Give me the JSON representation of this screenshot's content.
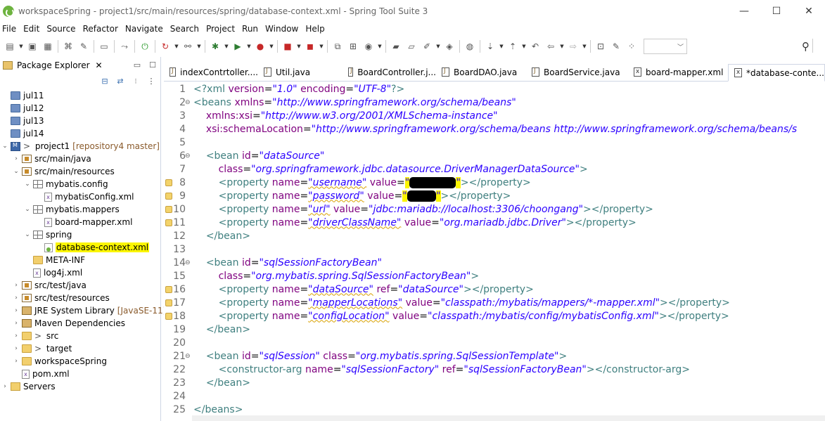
{
  "window": {
    "title": "workspaceSpring - project1/src/main/resources/spring/database-context.xml - Spring Tool Suite 3",
    "controls": [
      "—",
      "☐",
      "✕"
    ]
  },
  "menu": [
    "File",
    "Edit",
    "Source",
    "Refactor",
    "Navigate",
    "Search",
    "Project",
    "Run",
    "Window",
    "Help"
  ],
  "package_explorer": {
    "tab_label": "Package Explorer",
    "tree": [
      {
        "label": "jul11",
        "type": "proj-folder",
        "depth": 0,
        "twisty": ""
      },
      {
        "label": "jul12",
        "type": "proj-folder",
        "depth": 0,
        "twisty": ""
      },
      {
        "label": "jul13",
        "type": "proj-folder",
        "depth": 0,
        "twisty": ""
      },
      {
        "label": "jul14",
        "type": "proj-folder",
        "depth": 0,
        "twisty": ""
      },
      {
        "label": "project1",
        "prefix": "> ",
        "suffix": "[repository4 master]",
        "type": "project",
        "depth": 0,
        "twisty": "v"
      },
      {
        "label": "src/main/java",
        "type": "pkgroot",
        "depth": 1,
        "twisty": ">"
      },
      {
        "label": "src/main/resources",
        "type": "pkgroot",
        "depth": 1,
        "twisty": "v"
      },
      {
        "label": "mybatis.config",
        "type": "package",
        "depth": 2,
        "twisty": "v"
      },
      {
        "label": "mybatisConfig.xml",
        "type": "xml",
        "depth": 3,
        "twisty": ""
      },
      {
        "label": "mybatis.mappers",
        "type": "package",
        "depth": 2,
        "twisty": "v"
      },
      {
        "label": "board-mapper.xml",
        "type": "xml",
        "depth": 3,
        "twisty": ""
      },
      {
        "label": "spring",
        "type": "package",
        "depth": 2,
        "twisty": "v"
      },
      {
        "label": "database-context.xml",
        "type": "springxml",
        "depth": 3,
        "twisty": "",
        "highlight": true
      },
      {
        "label": "META-INF",
        "type": "folder",
        "depth": 2,
        "twisty": ""
      },
      {
        "label": "log4j.xml",
        "type": "xml",
        "depth": 2,
        "twisty": ""
      },
      {
        "label": "src/test/java",
        "type": "pkgroot",
        "depth": 1,
        "twisty": ">"
      },
      {
        "label": "src/test/resources",
        "type": "pkgroot",
        "depth": 1,
        "twisty": ">"
      },
      {
        "label": "JRE System Library",
        "suffix": "[JavaSE-11]",
        "type": "lib",
        "depth": 1,
        "twisty": ">"
      },
      {
        "label": "Maven Dependencies",
        "type": "lib",
        "depth": 1,
        "twisty": ">"
      },
      {
        "label": "src",
        "prefix": "> ",
        "type": "folder",
        "depth": 1,
        "twisty": ">"
      },
      {
        "label": "target",
        "prefix": "> ",
        "type": "folder",
        "depth": 1,
        "twisty": ">"
      },
      {
        "label": "workspaceSpring",
        "type": "folder",
        "depth": 1,
        "twisty": ">"
      },
      {
        "label": "pom.xml",
        "type": "xml",
        "depth": 1,
        "twisty": ""
      },
      {
        "label": "Servers",
        "type": "servers",
        "depth": 0,
        "twisty": ">"
      }
    ]
  },
  "editor_tabs": [
    {
      "label": "indexContrtoller....",
      "icon": "java"
    },
    {
      "label": "Util.java",
      "icon": "java"
    },
    {
      "label": "BoardController.j...",
      "icon": "java"
    },
    {
      "label": "BoardDAO.java",
      "icon": "java"
    },
    {
      "label": "BoardService.java",
      "icon": "java"
    },
    {
      "label": "board-mapper.xml",
      "icon": "xml"
    },
    {
      "label": "*database-conte...",
      "icon": "xml",
      "active": true
    }
  ],
  "editor": {
    "lines": [
      {
        "n": "1",
        "segs": [
          [
            "t",
            "<?"
          ],
          [
            "t",
            "xml "
          ],
          [
            "a",
            "version"
          ],
          [
            "p",
            "="
          ],
          [
            "v",
            "\"1.0\""
          ],
          [
            "p",
            " "
          ],
          [
            "a",
            "encoding"
          ],
          [
            "p",
            "="
          ],
          [
            "v",
            "\"UTF-8\""
          ],
          [
            "t",
            "?>"
          ]
        ]
      },
      {
        "n": "2",
        "fold": true,
        "segs": [
          [
            "t",
            "<beans "
          ],
          [
            "a",
            "xmlns"
          ],
          [
            "p",
            "="
          ],
          [
            "v",
            "\"http://www.springframework.org/schema/beans\""
          ]
        ]
      },
      {
        "n": "3",
        "segs": [
          [
            "p",
            "    "
          ],
          [
            "a",
            "xmlns:xsi"
          ],
          [
            "p",
            "="
          ],
          [
            "v",
            "\"http://www.w3.org/2001/XMLSchema-instance\""
          ]
        ]
      },
      {
        "n": "4",
        "segs": [
          [
            "p",
            "    "
          ],
          [
            "a",
            "xsi:schemaLocation"
          ],
          [
            "p",
            "="
          ],
          [
            "v",
            "\"http://www.springframework.org/schema/beans http://www.springframework.org/schema/beans/s"
          ]
        ]
      },
      {
        "n": "5",
        "segs": []
      },
      {
        "n": "6",
        "fold": true,
        "segs": [
          [
            "p",
            "    "
          ],
          [
            "t",
            "<bean "
          ],
          [
            "a",
            "id"
          ],
          [
            "p",
            "="
          ],
          [
            "v",
            "\"dataSource\""
          ]
        ]
      },
      {
        "n": "7",
        "segs": [
          [
            "p",
            "        "
          ],
          [
            "a",
            "class"
          ],
          [
            "p",
            "="
          ],
          [
            "v",
            "\"org.springframework.jdbc.datasource.DriverManagerDataSource\""
          ],
          [
            "t",
            ">"
          ]
        ]
      },
      {
        "n": "8",
        "warn": true,
        "segs": [
          [
            "p",
            "        "
          ],
          [
            "t",
            "<property "
          ],
          [
            "a",
            "name"
          ],
          [
            "p",
            "="
          ],
          [
            "vs",
            "\"username\""
          ],
          [
            "p",
            " "
          ],
          [
            "a",
            "value"
          ],
          [
            "p",
            "="
          ],
          [
            "yv",
            "\""
          ],
          [
            "r",
            "xxxxxxxx"
          ],
          [
            "yv",
            "\""
          ],
          [
            "t",
            "></property>"
          ]
        ]
      },
      {
        "n": "9",
        "warn": true,
        "segs": [
          [
            "p",
            "        "
          ],
          [
            "t",
            "<property "
          ],
          [
            "a",
            "name"
          ],
          [
            "p",
            "="
          ],
          [
            "vs",
            "\"password\""
          ],
          [
            "p",
            " "
          ],
          [
            "a",
            "value"
          ],
          [
            "p",
            "="
          ],
          [
            "yv",
            "\""
          ],
          [
            "r",
            "xxxxx"
          ],
          [
            "yv",
            "\""
          ],
          [
            "t",
            "></property>"
          ]
        ]
      },
      {
        "n": "10",
        "warn": true,
        "segs": [
          [
            "p",
            "        "
          ],
          [
            "t",
            "<property "
          ],
          [
            "a",
            "name"
          ],
          [
            "p",
            "="
          ],
          [
            "vs",
            "\"url\""
          ],
          [
            "p",
            " "
          ],
          [
            "a",
            "value"
          ],
          [
            "p",
            "="
          ],
          [
            "v",
            "\"jdbc:mariadb://localhost:3306/choongang\""
          ],
          [
            "t",
            "></property>"
          ]
        ]
      },
      {
        "n": "11",
        "warn": true,
        "segs": [
          [
            "p",
            "        "
          ],
          [
            "t",
            "<property "
          ],
          [
            "a",
            "name"
          ],
          [
            "p",
            "="
          ],
          [
            "vs",
            "\"driverClassName\""
          ],
          [
            "p",
            " "
          ],
          [
            "a",
            "value"
          ],
          [
            "p",
            "="
          ],
          [
            "v",
            "\"org.mariadb.jdbc.Driver\""
          ],
          [
            "t",
            "></property>"
          ]
        ]
      },
      {
        "n": "12",
        "segs": [
          [
            "p",
            "    "
          ],
          [
            "t",
            "</bean>"
          ]
        ]
      },
      {
        "n": "13",
        "segs": []
      },
      {
        "n": "14",
        "fold": true,
        "segs": [
          [
            "p",
            "    "
          ],
          [
            "t",
            "<bean "
          ],
          [
            "a",
            "id"
          ],
          [
            "p",
            "="
          ],
          [
            "v",
            "\"sqlSessionFactoryBean\""
          ]
        ]
      },
      {
        "n": "15",
        "segs": [
          [
            "p",
            "        "
          ],
          [
            "a",
            "class"
          ],
          [
            "p",
            "="
          ],
          [
            "v",
            "\"org.mybatis.spring.SqlSessionFactoryBean\""
          ],
          [
            "t",
            ">"
          ]
        ]
      },
      {
        "n": "16",
        "warn": true,
        "segs": [
          [
            "p",
            "        "
          ],
          [
            "t",
            "<property "
          ],
          [
            "a",
            "name"
          ],
          [
            "p",
            "="
          ],
          [
            "vs",
            "\"dataSource\""
          ],
          [
            "p",
            " "
          ],
          [
            "a",
            "ref"
          ],
          [
            "p",
            "="
          ],
          [
            "v",
            "\"dataSource\""
          ],
          [
            "t",
            "></property>"
          ]
        ]
      },
      {
        "n": "17",
        "warn": true,
        "segs": [
          [
            "p",
            "        "
          ],
          [
            "t",
            "<property "
          ],
          [
            "a",
            "name"
          ],
          [
            "p",
            "="
          ],
          [
            "vs",
            "\"mapperLocations\""
          ],
          [
            "p",
            " "
          ],
          [
            "a",
            "value"
          ],
          [
            "p",
            "="
          ],
          [
            "v",
            "\"classpath:/mybatis/mappers/*-mapper.xml\""
          ],
          [
            "t",
            "></property>"
          ]
        ]
      },
      {
        "n": "18",
        "warn": true,
        "segs": [
          [
            "p",
            "        "
          ],
          [
            "t",
            "<property "
          ],
          [
            "a",
            "name"
          ],
          [
            "p",
            "="
          ],
          [
            "vs",
            "\"configLocation\""
          ],
          [
            "p",
            " "
          ],
          [
            "a",
            "value"
          ],
          [
            "p",
            "="
          ],
          [
            "v",
            "\"classpath:/mybatis/config/mybatisConfig.xml\""
          ],
          [
            "t",
            "></property>"
          ]
        ]
      },
      {
        "n": "19",
        "segs": [
          [
            "p",
            "    "
          ],
          [
            "t",
            "</bean>"
          ]
        ]
      },
      {
        "n": "20",
        "segs": []
      },
      {
        "n": "21",
        "fold": true,
        "segs": [
          [
            "p",
            "    "
          ],
          [
            "t",
            "<bean "
          ],
          [
            "a",
            "id"
          ],
          [
            "p",
            "="
          ],
          [
            "v",
            "\"sqlSession\""
          ],
          [
            "p",
            " "
          ],
          [
            "a",
            "class"
          ],
          [
            "p",
            "="
          ],
          [
            "v",
            "\"org.mybatis.spring.SqlSessionTemplate\""
          ],
          [
            "t",
            ">"
          ]
        ]
      },
      {
        "n": "22",
        "segs": [
          [
            "p",
            "        "
          ],
          [
            "t",
            "<constructor-arg "
          ],
          [
            "a",
            "name"
          ],
          [
            "p",
            "="
          ],
          [
            "v",
            "\"sqlSessionFactory\""
          ],
          [
            "p",
            " "
          ],
          [
            "a",
            "ref"
          ],
          [
            "p",
            "="
          ],
          [
            "v",
            "\"sqlSessionFactoryBean\""
          ],
          [
            "t",
            "></constructor-arg>"
          ]
        ]
      },
      {
        "n": "23",
        "segs": [
          [
            "p",
            "    "
          ],
          [
            "t",
            "</bean>"
          ]
        ]
      },
      {
        "n": "24",
        "segs": []
      },
      {
        "n": "25",
        "segs": [
          [
            "t",
            "</beans>"
          ]
        ]
      }
    ]
  }
}
